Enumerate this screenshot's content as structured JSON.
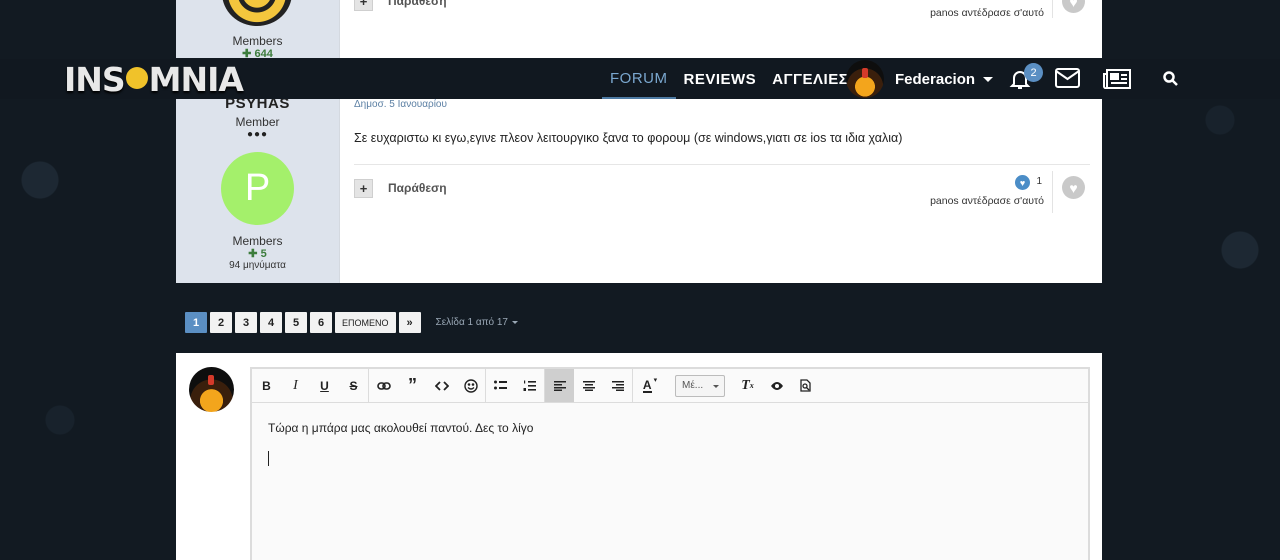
{
  "top_post": {
    "members_label": "Members",
    "reputation": "644",
    "quote_label": "Παράθεση",
    "reacted_by": "panos αντέδρασε σ'αυτό"
  },
  "navbar": {
    "logo_left": "INS",
    "logo_right": "MNIA",
    "links": [
      {
        "label": "FORUM",
        "active": true
      },
      {
        "label": "REVIEWS",
        "active": false
      },
      {
        "label": "ΑΓΓΕΛΙΕΣ",
        "active": false
      }
    ],
    "username": "Federacion",
    "notifications_count": "2"
  },
  "post": {
    "author": "PSYHAS",
    "role": "Member",
    "pips": "●●●",
    "avatar_letter": "P",
    "group": "Members",
    "reputation": "5",
    "posts": "94 μηνύματα",
    "date": "Δημοσ. 5 Ιανουαρίου",
    "text": "Σε ευχαριστω κι εγω,εγινε πλεον λειτουργικο ξανα το φορουμ (σε windows,γιατι σε ios τα ιδια χαλια)",
    "quote_label": "Παράθεση",
    "reaction_count": "1",
    "reacted_by": "panos αντέδρασε σ'αυτό"
  },
  "pagination": {
    "pages": [
      "1",
      "2",
      "3",
      "4",
      "5",
      "6"
    ],
    "next_label": "ΕΠΟΜΕΝΟ",
    "last_label": "»",
    "info": "Σελίδα 1 από 17"
  },
  "editor": {
    "size_label": "Μέ...",
    "content": "Τώρα η μπάρα μας ακολουθεί παντού. Δες το λίγο"
  },
  "colors": {
    "accent": "#5b8fc3",
    "nav_bg": "#111820",
    "page_bg": "#121a22",
    "avatar_green": "#a4f06b"
  }
}
